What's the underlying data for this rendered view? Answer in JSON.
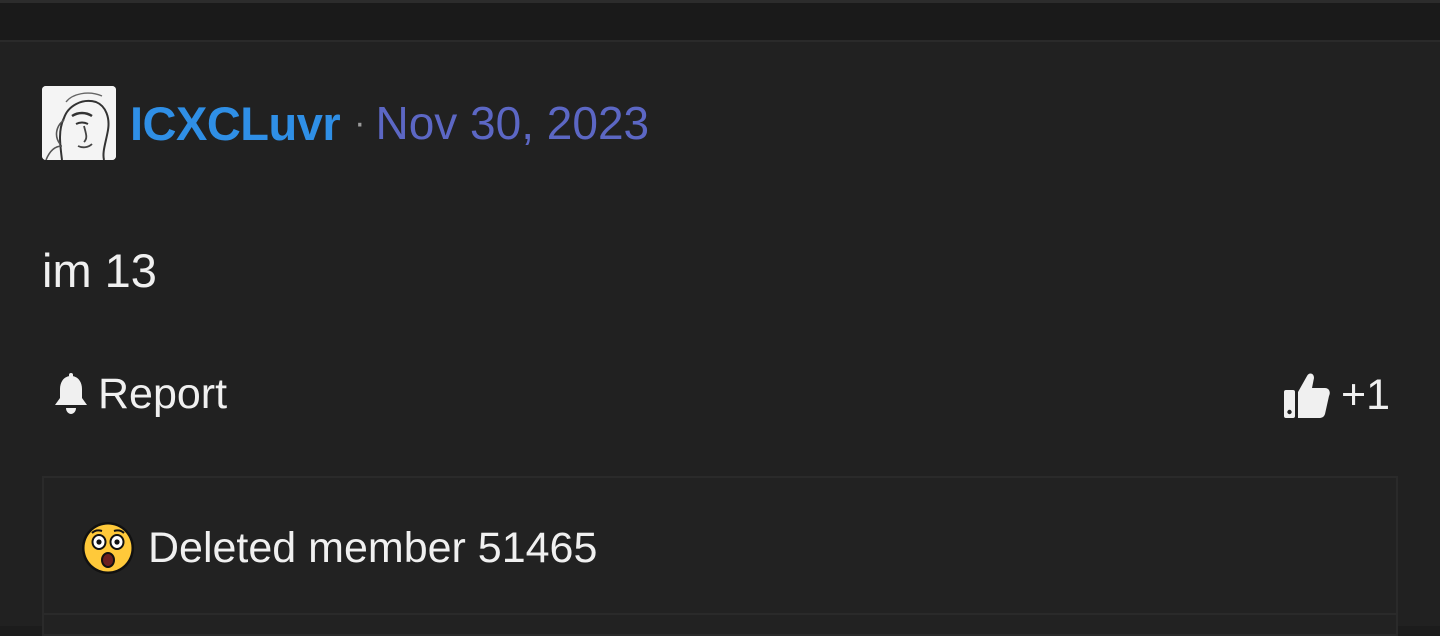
{
  "post": {
    "author": "ICXCLuvr",
    "separator": "·",
    "date": "Nov 30, 2023",
    "body": "im 13",
    "avatar_icon": "avatar-sketch-icon"
  },
  "actions": {
    "report_label": "Report",
    "report_icon": "bell-icon",
    "like_count": "+1",
    "like_icon": "thumbs-up-icon"
  },
  "reactions": {
    "items": [
      {
        "emoji": "astonished-face-emoji",
        "member": "Deleted member 51465"
      }
    ]
  },
  "colors": {
    "background": "#212121",
    "username": "#2f8fe6",
    "date": "#5c67c4",
    "text": "#f0f0f0"
  }
}
